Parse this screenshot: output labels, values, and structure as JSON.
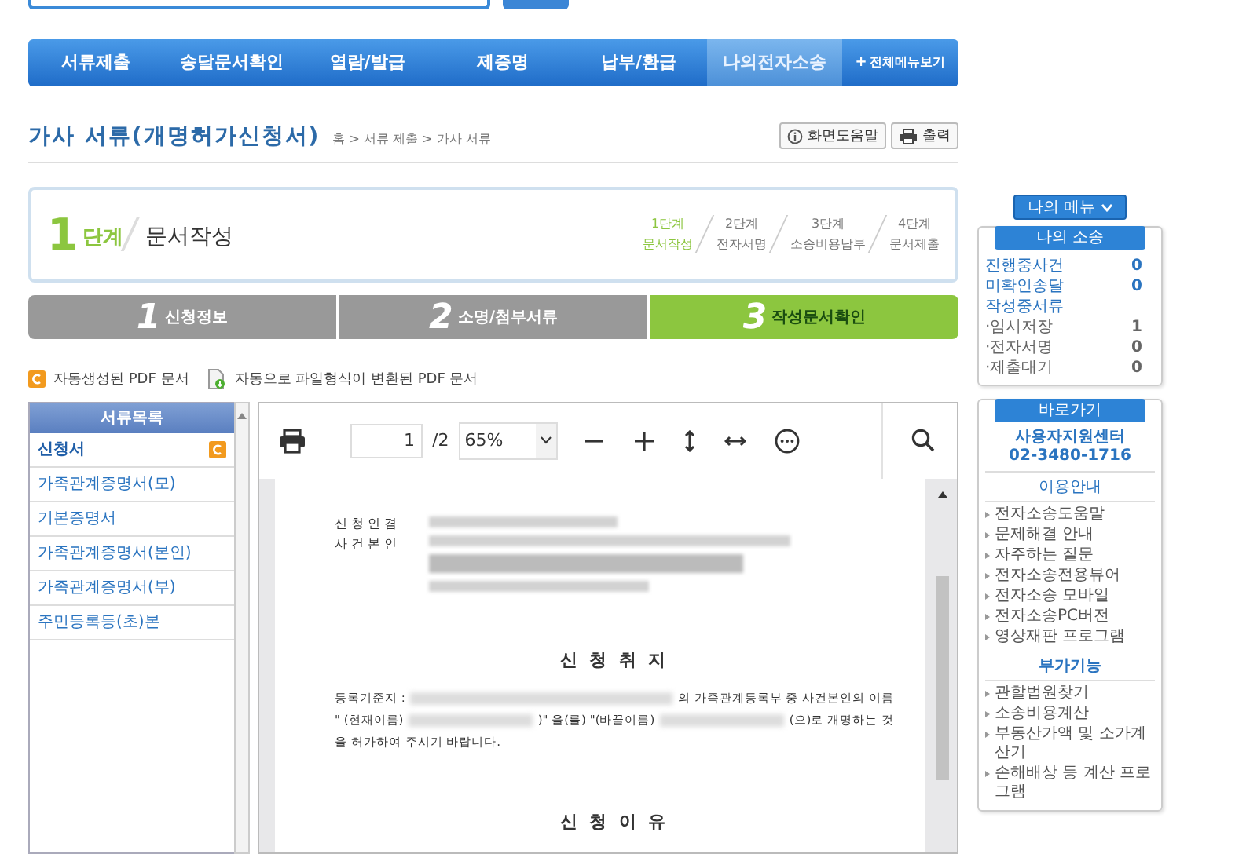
{
  "nav": [
    {
      "label": "서류제출",
      "selected": false
    },
    {
      "label": "송달문서확인",
      "selected": false
    },
    {
      "label": "열람/발급",
      "selected": false
    },
    {
      "label": "제증명",
      "selected": false
    },
    {
      "label": "납부/환급",
      "selected": false
    },
    {
      "label": "나의전자소송",
      "selected": true
    }
  ],
  "all_menu": {
    "icon": "+",
    "label": "전체메뉴보기"
  },
  "page_title": "가사 서류(개명허가신청서)",
  "breadcrumb": "홈 > 서류 제출 > 가사 서류",
  "help_button": "화면도움말",
  "print_button": "출력",
  "stage": {
    "number": "1",
    "unit": "단계",
    "title": "문서작성",
    "steps": [
      {
        "label": "1단계",
        "sub": "문서작성",
        "selected": true
      },
      {
        "label": "2단계",
        "sub": "전자서명",
        "selected": false
      },
      {
        "label": "3단계",
        "sub": "소송비용납부",
        "selected": false
      },
      {
        "label": "4단계",
        "sub": "문서제출",
        "selected": false
      }
    ]
  },
  "progress_tabs": [
    {
      "number": "1",
      "label": "신청정보",
      "selected": false
    },
    {
      "number": "2",
      "label": "소명/첨부서류",
      "selected": false
    },
    {
      "number": "3",
      "label": "작성문서확인",
      "selected": true
    }
  ],
  "legend": [
    {
      "kind": "auto",
      "label": "자동생성된 PDF 문서"
    },
    {
      "kind": "converted",
      "label": "자동으로 파일형식이 변환된 PDF 문서"
    }
  ],
  "doc_list": {
    "title": "서류목록",
    "items": [
      {
        "label": "신청서",
        "selected": true,
        "auto_pdf": true
      },
      {
        "label": "가족관계증명서(모)",
        "selected": false,
        "auto_pdf": false
      },
      {
        "label": "기본증명서",
        "selected": false,
        "auto_pdf": false
      },
      {
        "label": "가족관계증명서(본인)",
        "selected": false,
        "auto_pdf": false
      },
      {
        "label": "가족관계증명서(부)",
        "selected": false,
        "auto_pdf": false
      },
      {
        "label": "주민등록등(초)본",
        "selected": false,
        "auto_pdf": false
      }
    ]
  },
  "viewer": {
    "page": "1",
    "total": "/2",
    "zoom": "65%"
  },
  "document": {
    "party_labels": [
      "신 청 인 겸",
      "사 건 본 인"
    ],
    "sections": [
      {
        "heading": "신 청 취 지",
        "lines": [
          [
            {
              "kind": "text",
              "text": "등록기준지 :"
            },
            {
              "kind": "redacted"
            },
            {
              "kind": "text",
              "text": "의 가족관계등록부 중 사건본인의 이름"
            }
          ],
          [
            {
              "kind": "text",
              "text": "\" (현재이름)"
            },
            {
              "kind": "redacted"
            },
            {
              "kind": "text",
              "text": ")\" 을(를) \"(바꿀이름)"
            },
            {
              "kind": "redacted"
            },
            {
              "kind": "text",
              "text": "(으)로 개명하는 것"
            }
          ],
          [
            {
              "kind": "text",
              "text": "을 허가하여 주시기 바랍니다."
            }
          ]
        ]
      },
      {
        "heading": "신 청 이 유"
      }
    ]
  },
  "my_menu_button": "나의 메뉴",
  "my_lawsuit": {
    "title": "나의 소송",
    "rows": [
      {
        "kind": "main",
        "label": "진행중사건",
        "count": "0"
      },
      {
        "kind": "main",
        "label": "미확인송달",
        "count": "0"
      },
      {
        "kind": "heading",
        "label": "작성중서류"
      },
      {
        "kind": "sub",
        "label": "·임시저장",
        "count": "1"
      },
      {
        "kind": "sub",
        "label": "·전자서명",
        "count": "0"
      },
      {
        "kind": "sub",
        "label": "·제출대기",
        "count": "0"
      }
    ]
  },
  "shortcuts": {
    "title": "바로가기",
    "center": "사용자지원센터",
    "phone": "02-3480-1716",
    "guide_title": "이용안내",
    "guide_links": [
      "전자소송도움말",
      "문제해결 안내",
      "자주하는 질문",
      "전자소송전용뷰어",
      "전자소송 모바일",
      "전자소송PC버전",
      "영상재판 프로그램"
    ],
    "extra_title": "부가기능",
    "extra_links": [
      "관할법원찾기",
      "소송비용계산",
      "부동산가액 및 소가계산기",
      "손해배상 등 계산 프로그램"
    ]
  }
}
